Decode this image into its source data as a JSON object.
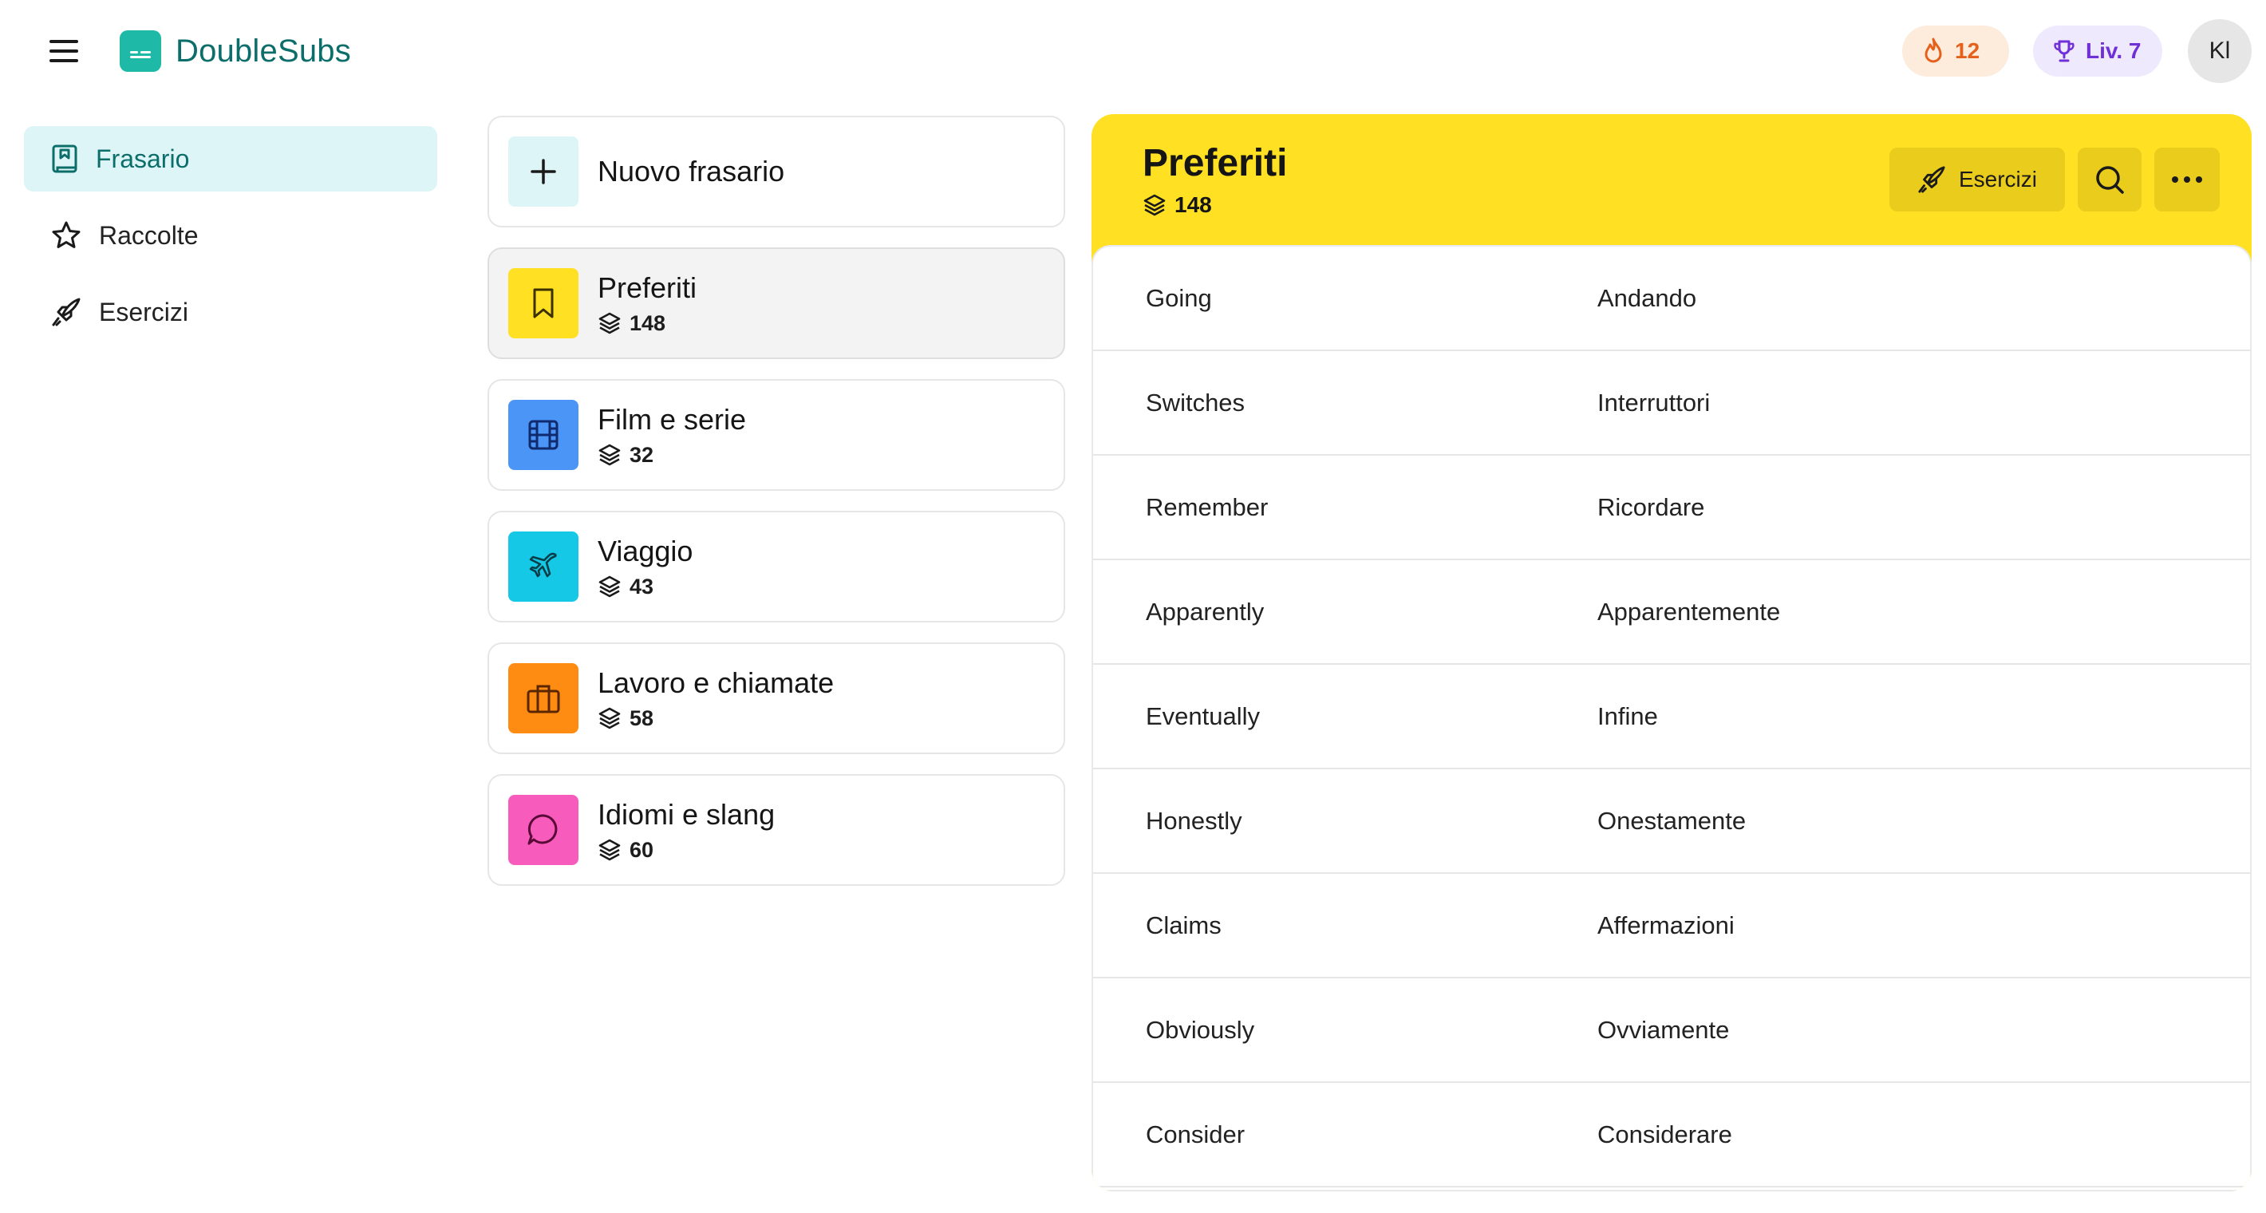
{
  "app": {
    "name": "DoubleSubs"
  },
  "header": {
    "streak": {
      "value": "12",
      "icon": "flame-icon",
      "color": "#e5601a"
    },
    "level": {
      "label": "Liv. 7",
      "icon": "trophy-icon",
      "color": "#7030d8"
    },
    "avatar_initials": "Kl"
  },
  "sidebar": {
    "items": [
      {
        "label": "Frasario",
        "icon": "phrasebook-icon",
        "active": true
      },
      {
        "label": "Raccolte",
        "icon": "star-icon",
        "active": false
      },
      {
        "label": "Esercizi",
        "icon": "rocket-icon",
        "active": false
      }
    ]
  },
  "collections": {
    "new_label": "Nuovo frasario",
    "items": [
      {
        "title": "Preferiti",
        "count": "148",
        "icon": "bookmark-icon",
        "color": "#ffe022",
        "selected": true
      },
      {
        "title": "Film e serie",
        "count": "32",
        "icon": "film-icon",
        "color": "#4a95f5",
        "selected": false
      },
      {
        "title": "Viaggio",
        "count": "43",
        "icon": "plane-icon",
        "color": "#14c8e6",
        "selected": false
      },
      {
        "title": "Lavoro e chiamate",
        "count": "58",
        "icon": "briefcase-icon",
        "color": "#ff8c12",
        "selected": false
      },
      {
        "title": "Idiomi e slang",
        "count": "60",
        "icon": "chat-bubble-icon",
        "color": "#f75bbc",
        "selected": false
      }
    ]
  },
  "detail": {
    "title": "Preferiti",
    "count": "148",
    "accent": "#ffe022",
    "exercises_label": "Esercizi",
    "phrases": [
      {
        "source": "Going",
        "translation": "Andando"
      },
      {
        "source": "Switches",
        "translation": "Interruttori"
      },
      {
        "source": "Remember",
        "translation": "Ricordare"
      },
      {
        "source": "Apparently",
        "translation": "Apparentemente"
      },
      {
        "source": "Eventually",
        "translation": "Infine"
      },
      {
        "source": "Honestly",
        "translation": "Onestamente"
      },
      {
        "source": "Claims",
        "translation": "Affermazioni"
      },
      {
        "source": "Obviously",
        "translation": "Ovviamente"
      },
      {
        "source": "Consider",
        "translation": "Considerare"
      }
    ]
  }
}
